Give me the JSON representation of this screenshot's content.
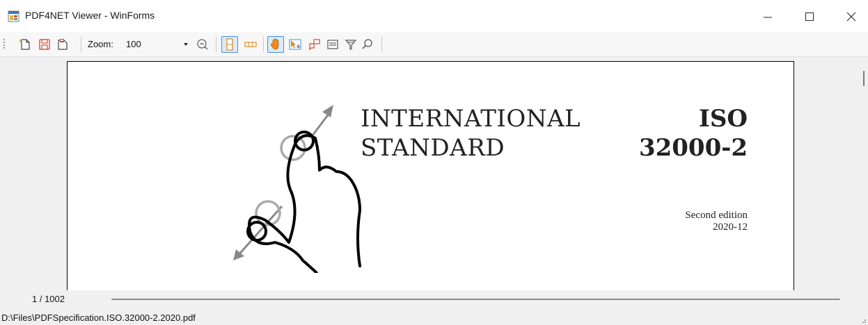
{
  "window": {
    "title": "PDF4NET Viewer - WinForms",
    "icon": "app-window-icon"
  },
  "toolbar": {
    "zoom_label": "Zoom:",
    "zoom_value": "100",
    "buttons": [
      {
        "name": "open-file-icon"
      },
      {
        "name": "save-file-icon"
      },
      {
        "name": "save-as-icon"
      },
      {
        "name": "zoom-out-icon"
      },
      {
        "name": "single-page-layout-icon"
      },
      {
        "name": "continuous-layout-icon"
      },
      {
        "name": "pan-tool-icon"
      },
      {
        "name": "text-select-icon"
      },
      {
        "name": "annotation-icon"
      },
      {
        "name": "form-field-icon"
      },
      {
        "name": "filter-icon"
      },
      {
        "name": "search-icon"
      }
    ],
    "accent": "#3d8ee6"
  },
  "document": {
    "title_line1": "INTERNATIONAL",
    "title_line2": "STANDARD",
    "iso": "ISO",
    "number": "32000-2",
    "edition": "Second edition",
    "date": "2020-12"
  },
  "navigation": {
    "page_indicator": "1 / 1002"
  },
  "status": {
    "file_path": "D:\\Files\\PDFSpecification.ISO.32000-2.2020.pdf"
  }
}
